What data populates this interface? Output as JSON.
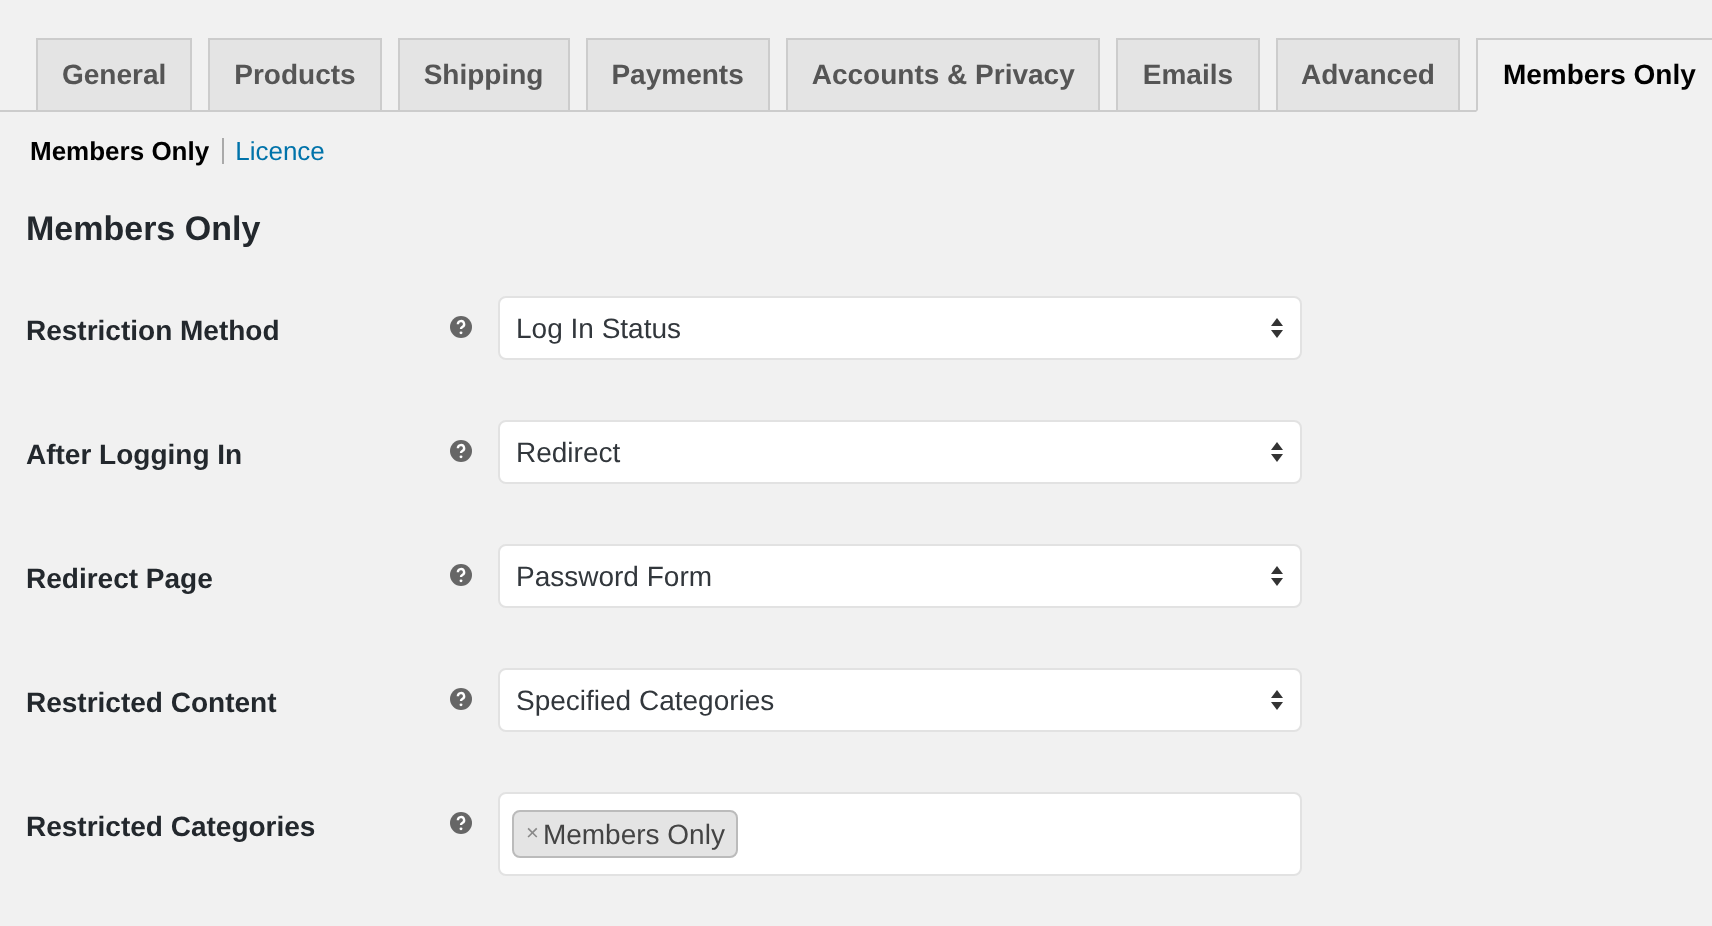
{
  "tabs": [
    {
      "label": "General",
      "selected": false
    },
    {
      "label": "Products",
      "selected": false
    },
    {
      "label": "Shipping",
      "selected": false
    },
    {
      "label": "Payments",
      "selected": false
    },
    {
      "label": "Accounts & Privacy",
      "selected": false
    },
    {
      "label": "Emails",
      "selected": false
    },
    {
      "label": "Advanced",
      "selected": false
    },
    {
      "label": "Members Only",
      "selected": true
    }
  ],
  "subnav": [
    {
      "label": "Members Only",
      "selected": true
    },
    {
      "label": "Licence",
      "selected": false
    }
  ],
  "heading": "Members Only",
  "fields": [
    {
      "label": "Restriction Method",
      "kind": "select",
      "value": "Log In Status"
    },
    {
      "label": "After Logging In",
      "kind": "select",
      "value": "Redirect"
    },
    {
      "label": "Redirect Page",
      "kind": "select",
      "value": "Password Form"
    },
    {
      "label": "Restricted Content",
      "kind": "select",
      "value": "Specified Categories"
    },
    {
      "label": "Restricted Categories",
      "kind": "tags",
      "tags": [
        {
          "remove": "×",
          "label": "Members Only"
        }
      ]
    }
  ]
}
